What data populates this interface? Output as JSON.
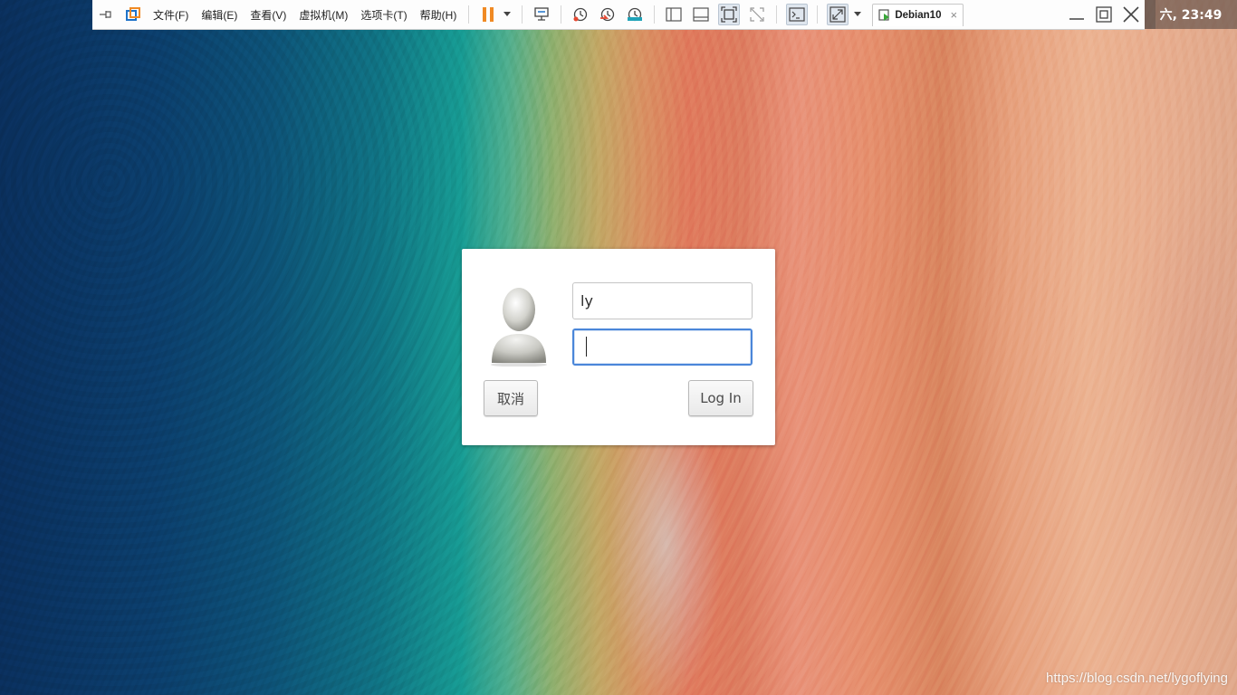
{
  "toolbar": {
    "menu": [
      "文件(F)",
      "编辑(E)",
      "查看(V)",
      "虚拟机(M)",
      "选项卡(T)",
      "帮助(H)"
    ],
    "tab_label": "Debian10",
    "tab_close": "×",
    "icons": [
      "pin-icon",
      "vmware-logo-icon",
      "pause-icon",
      "dropdown-icon",
      "send-ctrl-alt-del-icon",
      "snapshot-icon",
      "revert-snapshot-icon",
      "snapshot-manager-icon",
      "library-view-icon",
      "thumbnail-view-icon",
      "fit-guest-icon",
      "unity-icon",
      "console-icon",
      "fullscreen-icon",
      "minimize-icon",
      "restore-icon",
      "close-icon"
    ],
    "accent_color": "#f08a24"
  },
  "guest": {
    "clock": "六, 23:49"
  },
  "login": {
    "username_value": "ly",
    "password_value": "",
    "cancel_label": "取消",
    "login_label": "Log In",
    "focus_color": "#4a86d9"
  },
  "watermark": "https://blog.csdn.net/lygoflying"
}
